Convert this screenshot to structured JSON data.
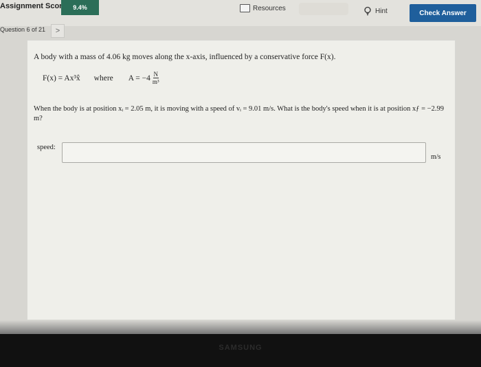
{
  "header": {
    "score_label": "Assignment Score:",
    "score_value": "9.4%",
    "resources_label": "Resources",
    "hint_label": "Hint",
    "check_answer_label": "Check Answer"
  },
  "question_nav": {
    "label": "Question 6 of 21",
    "next_symbol": ">"
  },
  "problem": {
    "intro": "A body with a mass of 4.06 kg moves along the x-axis, influenced by a conservative force F(x).",
    "force_formula": "F(x) = Ax³x̂",
    "where_text": "where",
    "a_lhs": "A = −4",
    "a_unit_num": "N",
    "a_unit_den": "m³",
    "body": "When the body is at position xᵢ = 2.05 m, it is moving with a speed of vᵢ = 9.01 m/s. What is the body's speed when it is at position xƒ = −2.99 m?"
  },
  "answer": {
    "label": "speed:",
    "value": "",
    "unit": "m/s"
  },
  "device": {
    "brand": "SAMSUNG"
  },
  "colors": {
    "score_bg": "#2b6e58",
    "check_btn_bg": "#1f5f9c"
  }
}
